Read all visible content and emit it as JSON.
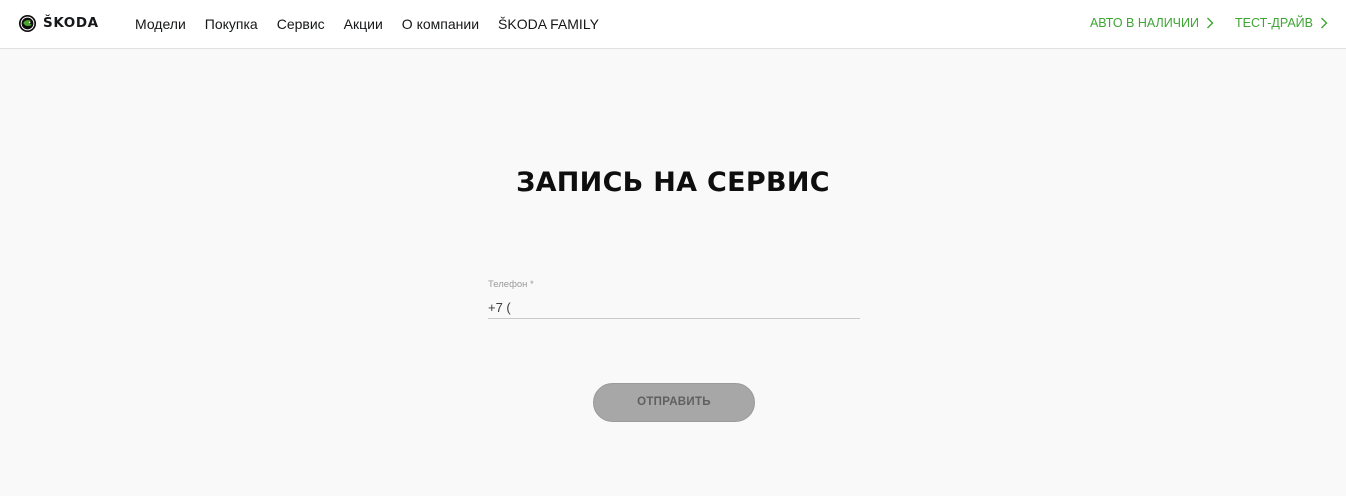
{
  "header": {
    "logo_text": "ŠKODA",
    "nav": [
      {
        "label": "Модели"
      },
      {
        "label": "Покупка"
      },
      {
        "label": "Сервис"
      },
      {
        "label": "Акции"
      },
      {
        "label": "О компании"
      },
      {
        "label": "ŠKODA FAMILY"
      }
    ],
    "cta": [
      {
        "label": "АВТО В НАЛИЧИИ",
        "icon": "chevron-right-icon"
      },
      {
        "label": "ТЕСТ-ДРАЙВ",
        "icon": "chevron-right-icon"
      }
    ],
    "accent_color": "#3fa535"
  },
  "main": {
    "title": "ЗАПИСЬ НА СЕРВИС",
    "phone": {
      "label": "Телефон *",
      "value": "+7 ("
    },
    "submit_label": "ОТПРАВИТЬ"
  }
}
